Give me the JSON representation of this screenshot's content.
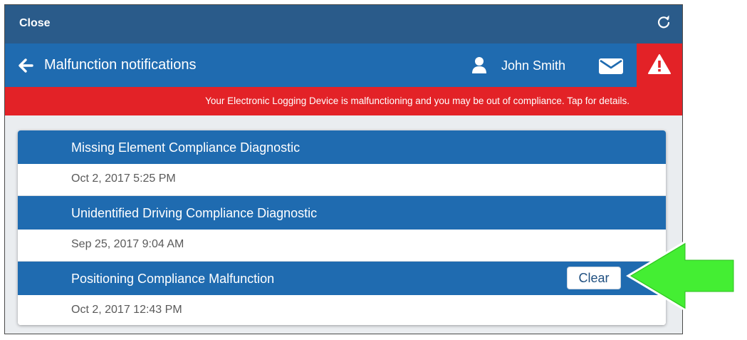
{
  "topbar": {
    "close_label": "Close",
    "refresh_icon": "refresh-icon"
  },
  "navbar": {
    "back_icon": "back-arrow-icon",
    "title": "Malfunction notifications",
    "user_icon": "user-icon",
    "username": "John Smith",
    "mail_icon": "mail-icon",
    "alert_icon": "warning-icon"
  },
  "banner": {
    "text": "Your Electronic Logging Device is malfunctioning and you may be out of compliance. Tap for details."
  },
  "notifications": [
    {
      "name": "Missing Element Compliance Diagnostic",
      "date": "Oct 2, 2017 5:25 PM"
    },
    {
      "name": "Unidentified Driving Compliance Diagnostic",
      "date": "Sep 25, 2017 9:04 AM"
    },
    {
      "name": "Positioning Compliance Malfunction",
      "date": "Oct 2, 2017 12:43 PM",
      "action_label": "Clear"
    }
  ],
  "colors": {
    "topbar": "#2a5b8a",
    "navbar": "#1f6bb0",
    "alert": "#e32227",
    "callout_arrow": "#44ee33"
  }
}
